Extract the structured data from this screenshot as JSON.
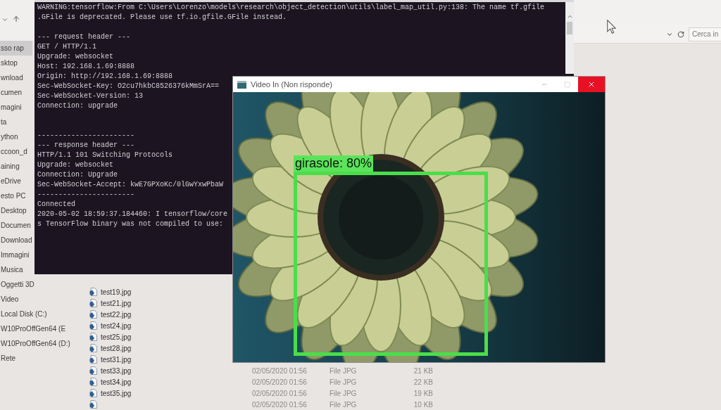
{
  "explorer": {
    "sidebar": {
      "items": [
        {
          "label": "sso rap",
          "selected": true
        },
        {
          "label": "sktop",
          "selected": false
        },
        {
          "label": "wnload",
          "selected": false
        },
        {
          "label": "cumen",
          "selected": false
        },
        {
          "label": "magini",
          "selected": false
        },
        {
          "label": "ta",
          "selected": false
        },
        {
          "label": "ython",
          "selected": false
        },
        {
          "label": "ccoon_d",
          "selected": false
        },
        {
          "label": "aining",
          "selected": false
        },
        {
          "label": "eDrive",
          "selected": false
        },
        {
          "label": "esto PC",
          "selected": false
        },
        {
          "label": "Desktop",
          "selected": false
        },
        {
          "label": "Documen",
          "selected": false
        },
        {
          "label": "Download",
          "selected": false
        },
        {
          "label": "Immagini",
          "selected": false
        },
        {
          "label": "Musica",
          "selected": false
        },
        {
          "label": "Oggetti 3D",
          "selected": false
        },
        {
          "label": "Video",
          "selected": false
        },
        {
          "label": "Local Disk (C:)",
          "selected": false
        },
        {
          "label": "W10ProOffGen64 (E",
          "selected": false
        },
        {
          "label": "W10ProOffGen64 (D:)",
          "selected": false
        },
        {
          "label": "Rete",
          "selected": false
        }
      ]
    },
    "search": {
      "placeholder": "Cerca in"
    },
    "files": [
      {
        "name": "test19.jpg"
      },
      {
        "name": "test21.jpg"
      },
      {
        "name": "test22.jpg"
      },
      {
        "name": "test24.jpg"
      },
      {
        "name": "test25.jpg"
      },
      {
        "name": "test28.jpg"
      },
      {
        "name": "test31.jpg"
      },
      {
        "name": "test33.jpg",
        "date": "02/05/2020 01:56",
        "type": "File JPG",
        "size": "21 KB"
      },
      {
        "name": "test34.jpg",
        "date": "02/05/2020 01:56",
        "type": "File JPG",
        "size": "22 KB"
      },
      {
        "name": "test35.jpg",
        "date": "02/05/2020 01:56",
        "type": "File JPG",
        "size": "19 KB"
      },
      {
        "date": "02/05/2020 01:56",
        "type": "File JPG",
        "size": "10 KB"
      }
    ]
  },
  "terminal": {
    "sections": [
      [
        "WARNING:tensorflow:From C:\\Users\\Lorenzo\\models\\research\\object_detection\\utils\\label_map_util.py:138: The name tf.gfile",
        ".GFile is deprecated. Please use tf.io.gfile.GFile instead."
      ],
      [
        "--- request header ---",
        "GET / HTTP/1.1",
        "Upgrade: websocket",
        "Host: 192.168.1.69:8888",
        "Origin: http://192.168.1.69:8888",
        "Sec-WebSocket-Key: O2cu7hkbC8526376kMmSrA==",
        "Sec-WebSocket-Version: 13",
        "Connection: upgrade"
      ],
      [
        "-----------------------",
        "--- response header ---",
        "HTTP/1.1 101 Switching Protocols",
        "Upgrade: websocket",
        "Connection: Upgrade",
        "Sec-WebSocket-Accept: kwE7GPXoKc/0lGwYxwPbaW",
        "-----------------------",
        "Connected",
        "2020-05-02 18:59:37.184460: I tensorflow/core",
        "s TensorFlow binary was not compiled to use:"
      ]
    ]
  },
  "video_window": {
    "title": "Video In (Non risponde)",
    "detection": {
      "label": "girasole: 80%"
    }
  }
}
